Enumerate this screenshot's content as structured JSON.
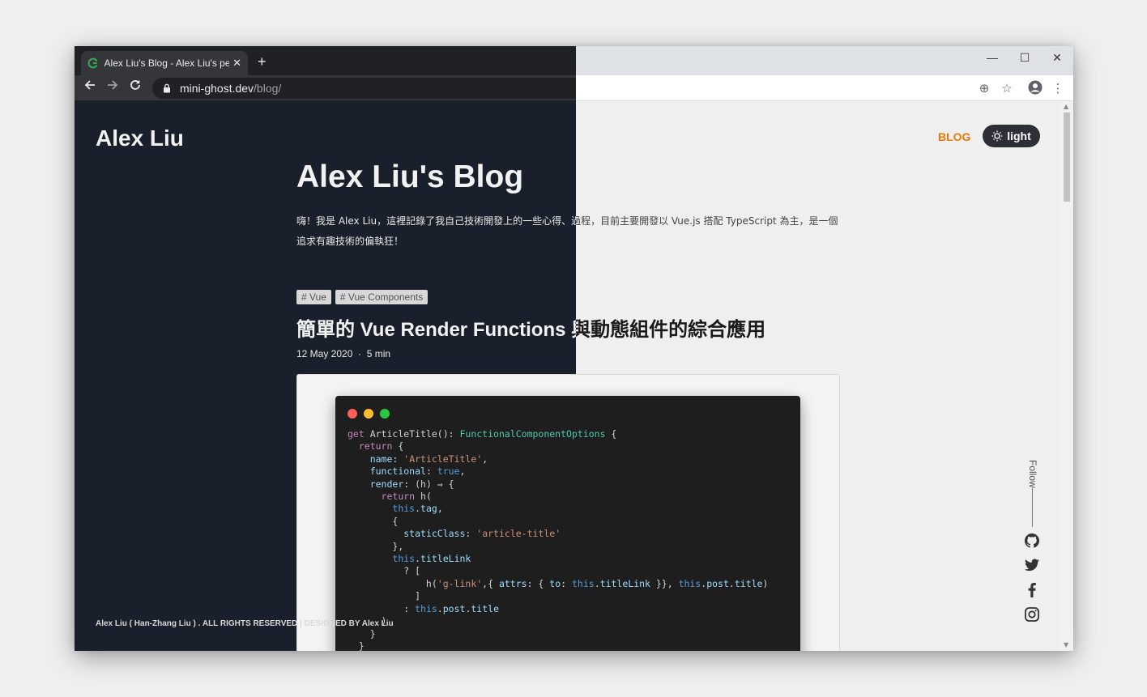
{
  "browser": {
    "tab_title": "Alex Liu's Blog - Alex Liu's personal blog",
    "new_tab": "+",
    "close_tab": "✕",
    "url_host": "mini-ghost.dev",
    "url_path": "/blog/"
  },
  "site": {
    "name": "Alex Liu",
    "nav_blog": "BLOG",
    "theme_toggle": "light"
  },
  "blog": {
    "title": "Alex Liu's Blog",
    "intro": "嗨！我是 Alex Liu，這裡記錄了我自己技術開發上的一些心得、過程，目前主要開發以 Vue.js 搭配 TypeScript 為主，是一個追求有趣技術的偏執狂！"
  },
  "post": {
    "tags": [
      "# Vue",
      "# Vue Components"
    ],
    "title": "簡單的 Vue Render Functions 與動態組件的綜合應用",
    "date": "12 May 2020",
    "separator": "·",
    "read_time": "5 min"
  },
  "footer": {
    "text": "Alex Liu ( Han-Zhang Liu ) . ALL RIGHTS RESERVED | DESIGNED BY Alex Liu"
  },
  "follow": {
    "label": "Follow",
    "links": [
      "github-icon",
      "twitter-icon",
      "facebook-icon",
      "instagram-icon"
    ]
  },
  "colors": {
    "accent": "#e8780a",
    "dark_bg": "#19202b",
    "light_bg": "#efefef"
  }
}
